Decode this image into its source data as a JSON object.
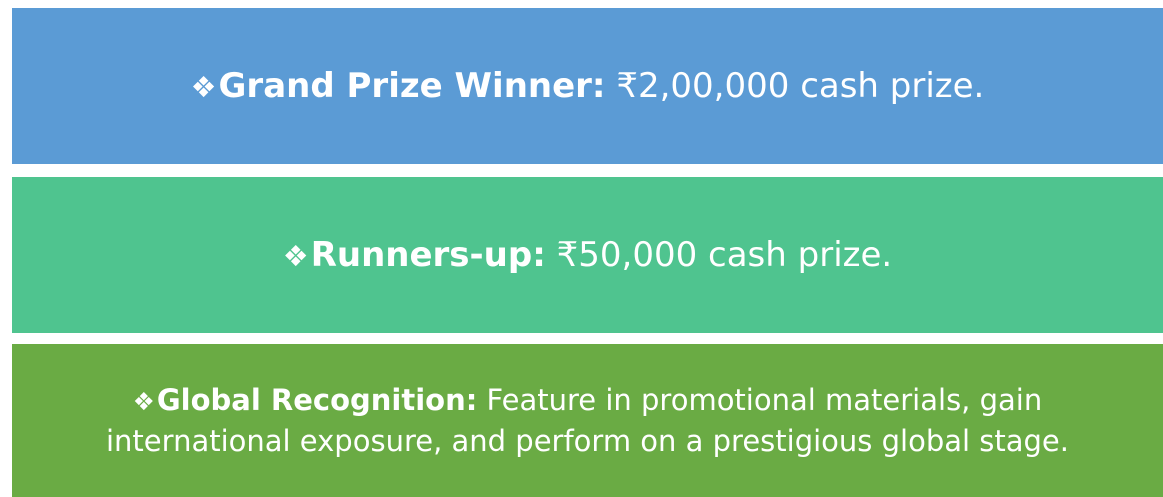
{
  "colors": {
    "grand_bg": "#5b9bd5",
    "runners_bg": "#4fc48f",
    "global_bg": "#6aab44",
    "text": "#ffffff"
  },
  "icons": {
    "bullet": "diamond-bullet-icon",
    "bullet_glyph": "❖"
  },
  "grand": {
    "label": "Grand Prize Winner:",
    "value": "₹2,00,000 cash prize."
  },
  "runners": {
    "label": "Runners-up:",
    "value": "₹50,000 cash prize."
  },
  "global": {
    "label": "Global Recognition:",
    "text_line1": "Feature in promotional materials, gain",
    "text_line2": "international exposure, and perform on a prestigious global stage."
  }
}
